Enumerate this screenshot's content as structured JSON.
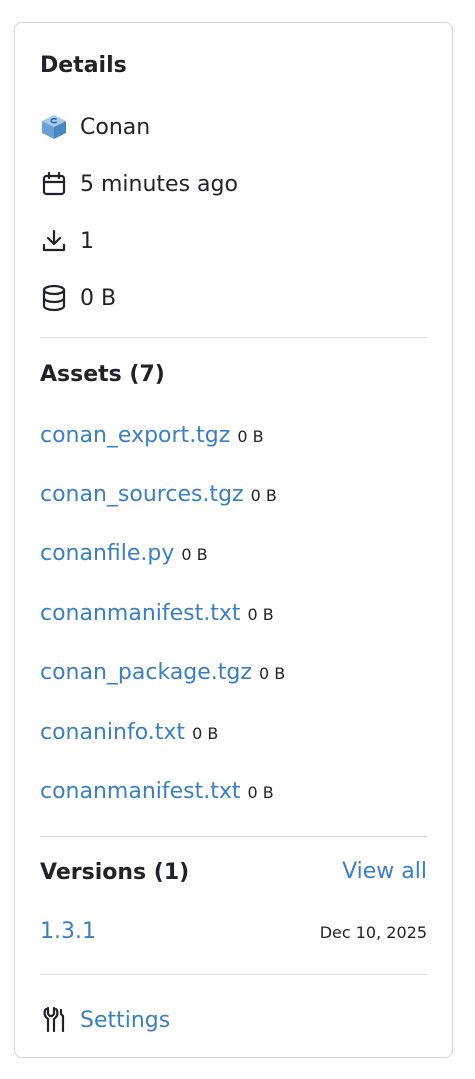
{
  "details": {
    "heading": "Details",
    "package_type": "Conan",
    "created": "5 minutes ago",
    "downloads": "1",
    "size": "0 B"
  },
  "assets": {
    "heading": "Assets (7)",
    "items": [
      {
        "name": "conan_export.tgz",
        "size": "0 B"
      },
      {
        "name": "conan_sources.tgz",
        "size": "0 B"
      },
      {
        "name": "conanfile.py",
        "size": "0 B"
      },
      {
        "name": "conanmanifest.txt",
        "size": "0 B"
      },
      {
        "name": "conan_package.tgz",
        "size": "0 B"
      },
      {
        "name": "conaninfo.txt",
        "size": "0 B"
      },
      {
        "name": "conanmanifest.txt",
        "size": "0 B"
      }
    ]
  },
  "versions": {
    "heading": "Versions (1)",
    "view_all": "View all",
    "items": [
      {
        "version": "1.3.1",
        "date": "Dec 10, 2025"
      }
    ]
  },
  "settings": {
    "label": "Settings"
  },
  "colors": {
    "link": "#3b7fc1",
    "text": "#1f2328",
    "border": "#d0d7de"
  }
}
